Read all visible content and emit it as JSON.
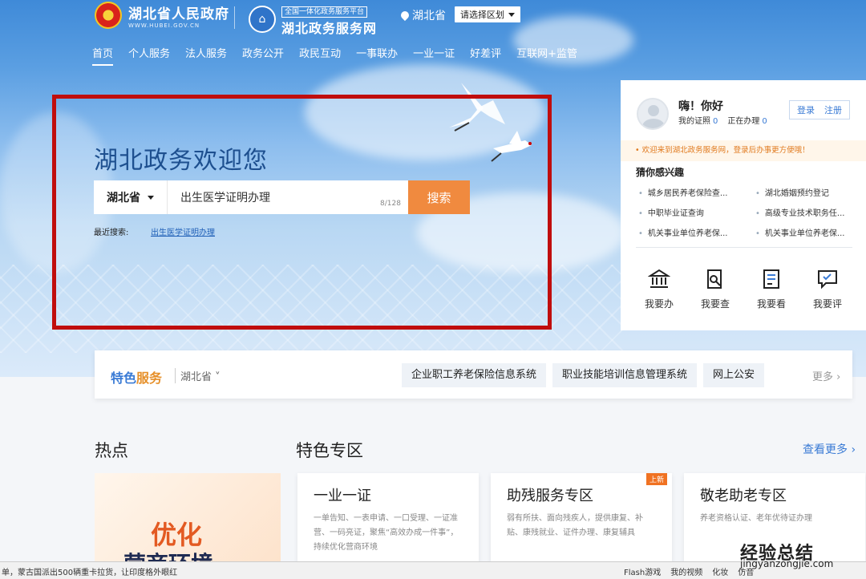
{
  "header": {
    "gov_name": "湖北省人民政府",
    "gov_url": "WWW.HUBEI.GOV.CN",
    "platform_badge": "全国一体化政务服务平台",
    "platform_name": "湖北政务服务网",
    "location": "湖北省",
    "region_select": "请选择区划"
  },
  "nav": [
    "首页",
    "个人服务",
    "法人服务",
    "政务公开",
    "政民互动",
    "一事联办",
    "一业一证",
    "好差评",
    "互联网+监管"
  ],
  "hero": {
    "welcome": "湖北政务欢迎您",
    "province": "湖北省",
    "search_value": "出生医学证明办理",
    "counter": "8/128",
    "search_button": "搜索",
    "recent_label": "最近搜索:",
    "recent_link": "出生医学证明办理"
  },
  "side": {
    "greeting": "嗨！你好",
    "certs_label": "我的证照",
    "certs_count": "0",
    "processing_label": "正在办理",
    "processing_count": "0",
    "login": "登录",
    "register": "注册",
    "notice": "• 欢迎来到湖北政务服务网，登录后办事更方便哦！",
    "interest_title": "猜你感兴趣",
    "interests": [
      "城乡居民养老保险查...",
      "湖北婚姻预约登记",
      "中职毕业证查询",
      "高级专业技术职务任...",
      "机关事业单位养老保...",
      "机关事业单位养老保..."
    ],
    "quick": [
      {
        "label": "我要办",
        "icon": "bank-icon"
      },
      {
        "label": "我要查",
        "icon": "search-doc-icon"
      },
      {
        "label": "我要看",
        "icon": "document-icon"
      },
      {
        "label": "我要评",
        "icon": "comment-icon"
      }
    ]
  },
  "feature": {
    "title_a": "特色",
    "title_b": "服务",
    "province": "湖北省",
    "tags": [
      "企业职工养老保险信息系统",
      "职业技能培训信息管理系统",
      "网上公安"
    ],
    "more": "更多"
  },
  "sections": {
    "hot": "热点",
    "zone": "特色专区",
    "see_more": "查看更多",
    "hot_big": "优化",
    "hot_big2": "营商环境"
  },
  "cards": [
    {
      "title": "一业一证",
      "desc": "一单告知、一表申请、一口受理、一证准营、一码亮证，聚焦“高效办成一件事”，持续优化营商环境",
      "tag": ""
    },
    {
      "title": "助残服务专区",
      "desc": "弱有所扶、面向残疾人，提供康复、补贴、康残就业、证件办理、康复辅具",
      "tag": "上新"
    },
    {
      "title": "敬老助老专区",
      "desc": "养老资格认证、老年优待证办理",
      "tag": ""
    }
  ],
  "statusbar": {
    "left": "单，蒙古国派出500辆重卡拉货，让印度格外眼红",
    "items": [
      "Flash游戏",
      "我的视频",
      "化妆",
      "仿音"
    ]
  },
  "watermark": {
    "text": "经验总结",
    "url": "jingyanzongjie.com"
  },
  "colors": {
    "accent": "#3a7bd5",
    "search_button": "#f08a3f",
    "highlight_box": "#c00d0d"
  }
}
